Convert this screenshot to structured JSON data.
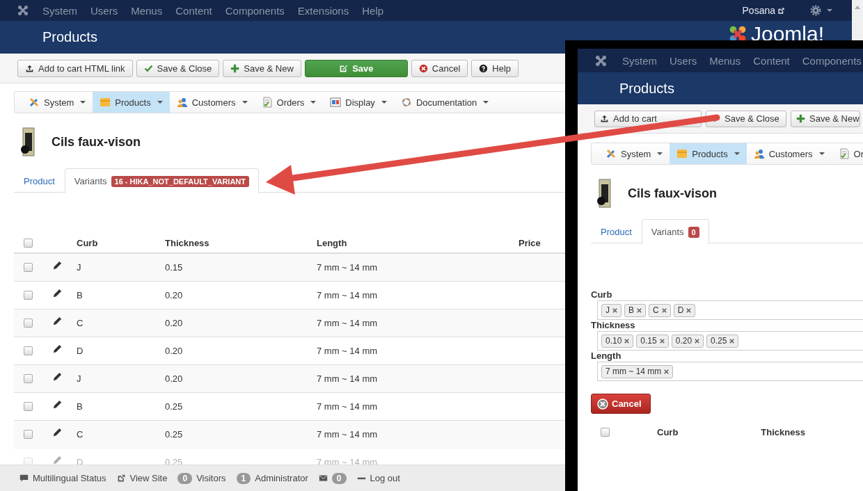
{
  "top_nav": {
    "items": [
      "System",
      "Users",
      "Menus",
      "Content",
      "Components",
      "Extensions",
      "Help"
    ],
    "user": "Posana"
  },
  "header": {
    "title": "Products",
    "logo": "Joomla!"
  },
  "toolbar": [
    {
      "label": "Add to cart HTML link",
      "kind": "default"
    },
    {
      "label": "Save & Close",
      "kind": "default"
    },
    {
      "label": "Save & New",
      "kind": "default"
    },
    {
      "label": "Save",
      "kind": "success"
    },
    {
      "label": "Cancel",
      "kind": "default"
    },
    {
      "label": "Help",
      "kind": "default"
    }
  ],
  "submenu": [
    {
      "label": "System",
      "selected": false
    },
    {
      "label": "Products",
      "selected": true
    },
    {
      "label": "Customers",
      "selected": false
    },
    {
      "label": "Orders",
      "selected": false
    },
    {
      "label": "Display",
      "selected": false
    },
    {
      "label": "Documentation",
      "selected": false
    }
  ],
  "product": {
    "name": "Cils faux-vison"
  },
  "tabs": [
    {
      "label": "Product",
      "selected": false
    },
    {
      "label": "Variants",
      "selected": true,
      "badge": "16 - HIKA_NOT_DEFAULT_VARIANT"
    }
  ],
  "table": {
    "columns": [
      "Curb",
      "Thickness",
      "Length",
      "Price"
    ],
    "select_all": {
      "checked": false
    },
    "rows": [
      {
        "checked": false,
        "curb": "J",
        "thickness": "0.15",
        "length": "7 mm ~ 14 mm",
        "dimmed": false
      },
      {
        "checked": false,
        "curb": "B",
        "thickness": "0.20",
        "length": "7 mm ~ 14 mm",
        "dimmed": false
      },
      {
        "checked": false,
        "curb": "C",
        "thickness": "0.20",
        "length": "7 mm ~ 14 mm",
        "dimmed": false
      },
      {
        "checked": false,
        "curb": "D",
        "thickness": "0.20",
        "length": "7 mm ~ 14 mm",
        "dimmed": false
      },
      {
        "checked": false,
        "curb": "J",
        "thickness": "0.20",
        "length": "7 mm ~ 14 mm",
        "dimmed": false
      },
      {
        "checked": false,
        "curb": "B",
        "thickness": "0.25",
        "length": "7 mm ~ 14 mm",
        "dimmed": false
      },
      {
        "checked": false,
        "curb": "C",
        "thickness": "0.25",
        "length": "7 mm ~ 14 mm",
        "dimmed": false
      },
      {
        "checked": false,
        "curb": "D",
        "thickness": "0.25",
        "length": "7 mm ~ 14 mm",
        "dimmed": true
      }
    ]
  },
  "status_bar": [
    {
      "label": "Multilingual Status"
    },
    {
      "label": "View Site"
    },
    {
      "badge": "0",
      "label": "Visitors"
    },
    {
      "badge": "1",
      "label": "Administrator"
    },
    {
      "badge": "0"
    },
    {
      "label": "Log out"
    }
  ],
  "overlay": {
    "top_nav": [
      "System",
      "Users",
      "Menus",
      "Content",
      "Components"
    ],
    "title": "Products",
    "toolbar": [
      "Add to cart",
      "Save & Close",
      "Save & New"
    ],
    "submenu": [
      {
        "label": "System",
        "selected": false
      },
      {
        "label": "Products",
        "selected": true
      },
      {
        "label": "Customers",
        "selected": false
      },
      {
        "label": "Or",
        "selected": false
      }
    ],
    "product": "Cils faux-vison",
    "tabs": [
      {
        "label": "Product",
        "selected": false
      },
      {
        "label": "Variants",
        "selected": true,
        "badge": "0"
      }
    ],
    "fields": [
      {
        "label": "Curb",
        "tags": [
          "J",
          "B",
          "C",
          "D"
        ]
      },
      {
        "label": "Thickness",
        "tags": [
          "0.10",
          "0.15",
          "0.20",
          "0.25"
        ]
      },
      {
        "label": "Length",
        "tags": [
          "7 mm ~ 14 mm"
        ]
      }
    ],
    "cancel": "Cancel",
    "select_all": {
      "checked": false
    },
    "table_columns": [
      "Curb",
      "Thickness"
    ]
  }
}
